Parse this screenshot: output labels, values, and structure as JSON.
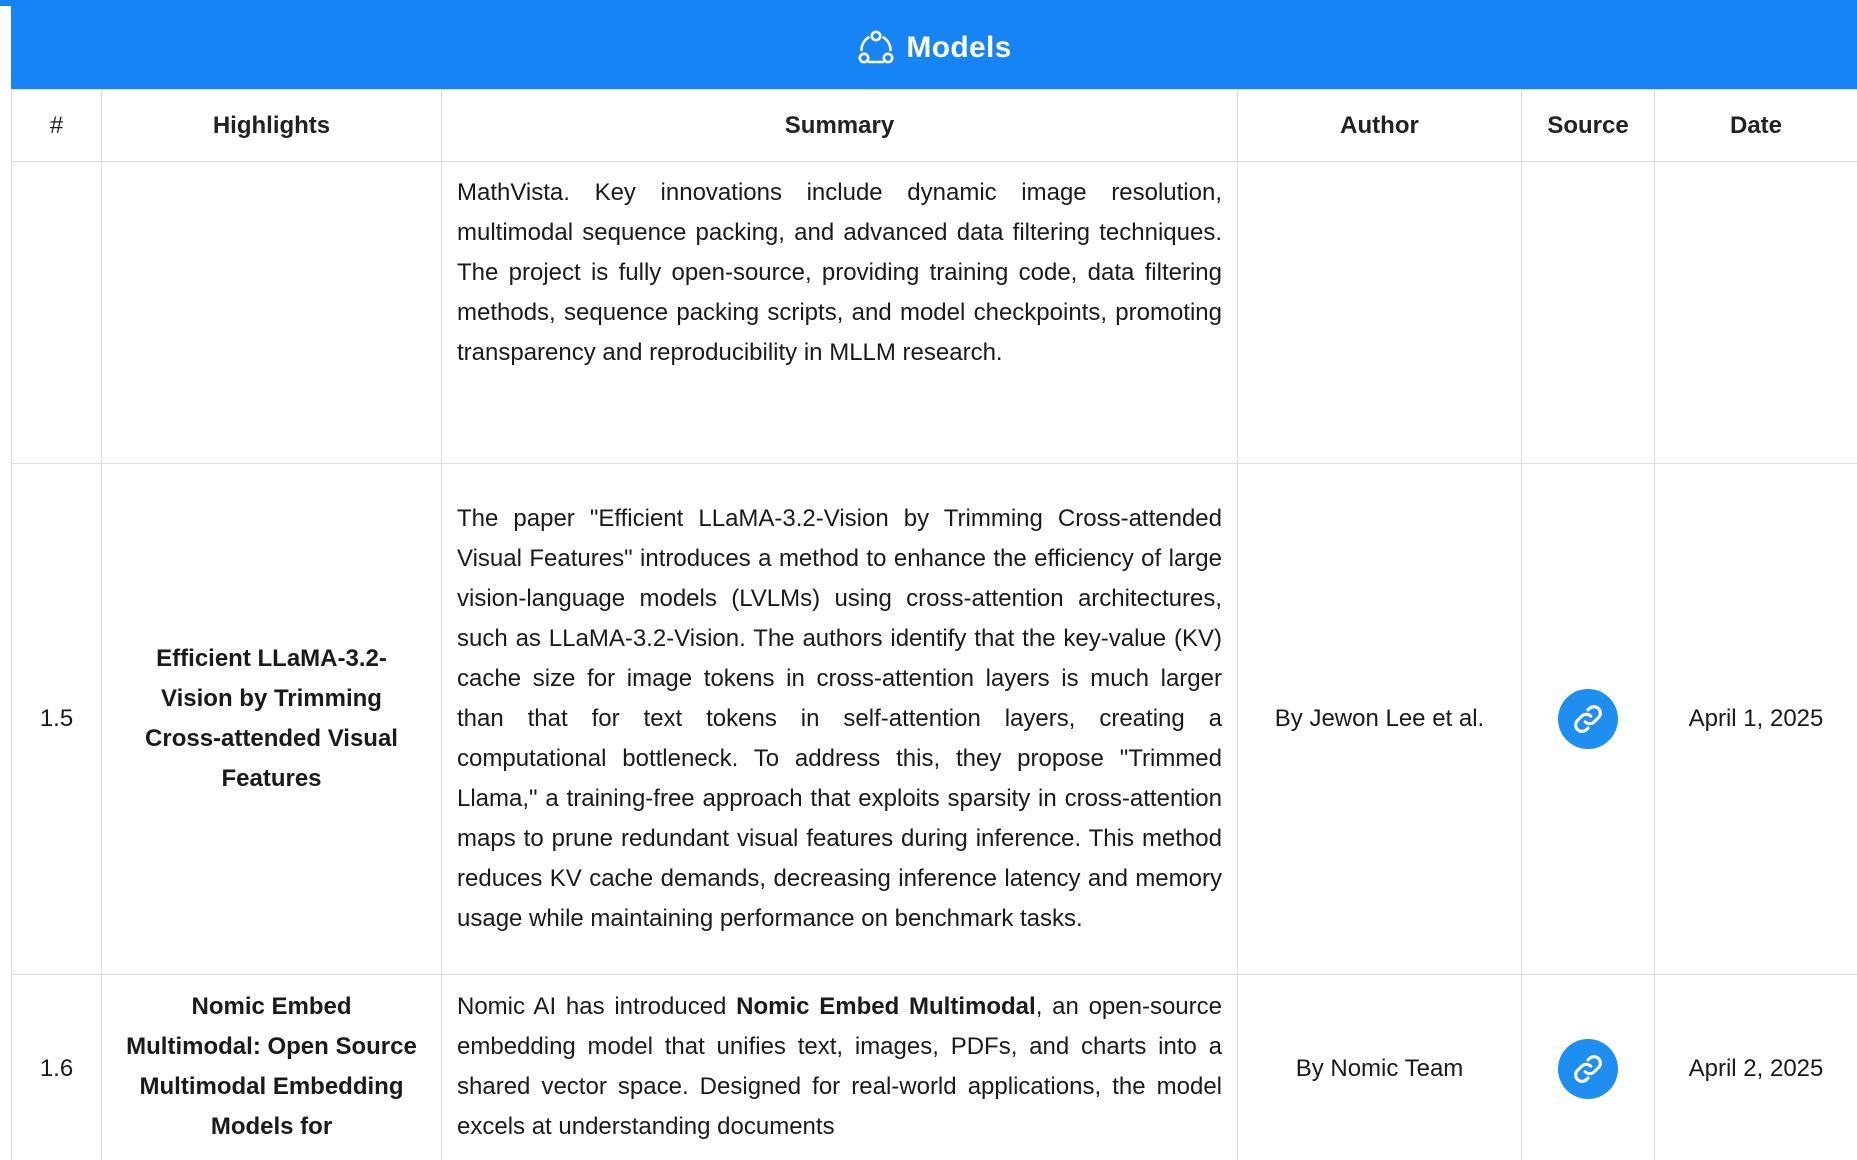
{
  "header": {
    "title": "Models",
    "icon": "nodes-cycle-icon",
    "accent_color": "#1784f6"
  },
  "columns": {
    "num": "#",
    "highlights": "Highlights",
    "summary": "Summary",
    "author": "Author",
    "source": "Source",
    "date": "Date"
  },
  "rows": [
    {
      "num": "",
      "highlight": "",
      "summary": "MathVista. Key innovations include dynamic image resolution, multimodal sequence packing, and advanced data filtering techniques. The project is fully open-source, providing training code, data filtering methods, sequence packing scripts, and model checkpoints, promoting transparency and reproducibility in MLLM research.",
      "author": "",
      "date": ""
    },
    {
      "num": "1.5",
      "highlight": "Efficient LLaMA-3.2-Vision by Trimming Cross-attended Visual Features",
      "summary": "The paper \"Efficient LLaMA-3.2-Vision by Trimming Cross-attended Visual Features\" introduces a method to enhance the efficiency of large vision-language models (LVLMs) using cross-attention architectures, such as LLaMA-3.2-Vision. The authors identify that the key-value (KV) cache size for image tokens in cross-attention layers is much larger than that for text tokens in self-attention layers, creating a computational bottleneck. To address this, they propose \"Trimmed Llama,\" a training-free approach that exploits sparsity in cross-attention maps to prune redundant visual features during inference. This method reduces KV cache demands, decreasing inference latency and memory usage while maintaining performance on benchmark tasks.",
      "author": "By Jewon Lee et al.",
      "source_icon": "link-icon",
      "date": "April 1, 2025"
    },
    {
      "num": "1.6",
      "highlight": "Nomic Embed Multimodal: Open Source Multimodal Embedding Models for",
      "summary_pre": "Nomic AI has introduced ",
      "summary_bold": "Nomic Embed Multimodal",
      "summary_post": ", an open-source embedding model that unifies text, images, PDFs, and charts into a shared vector space. Designed for real-world applications, the model excels at understanding documents",
      "author": "By Nomic Team",
      "source_icon": "link-icon",
      "date": "April 2, 2025"
    }
  ]
}
